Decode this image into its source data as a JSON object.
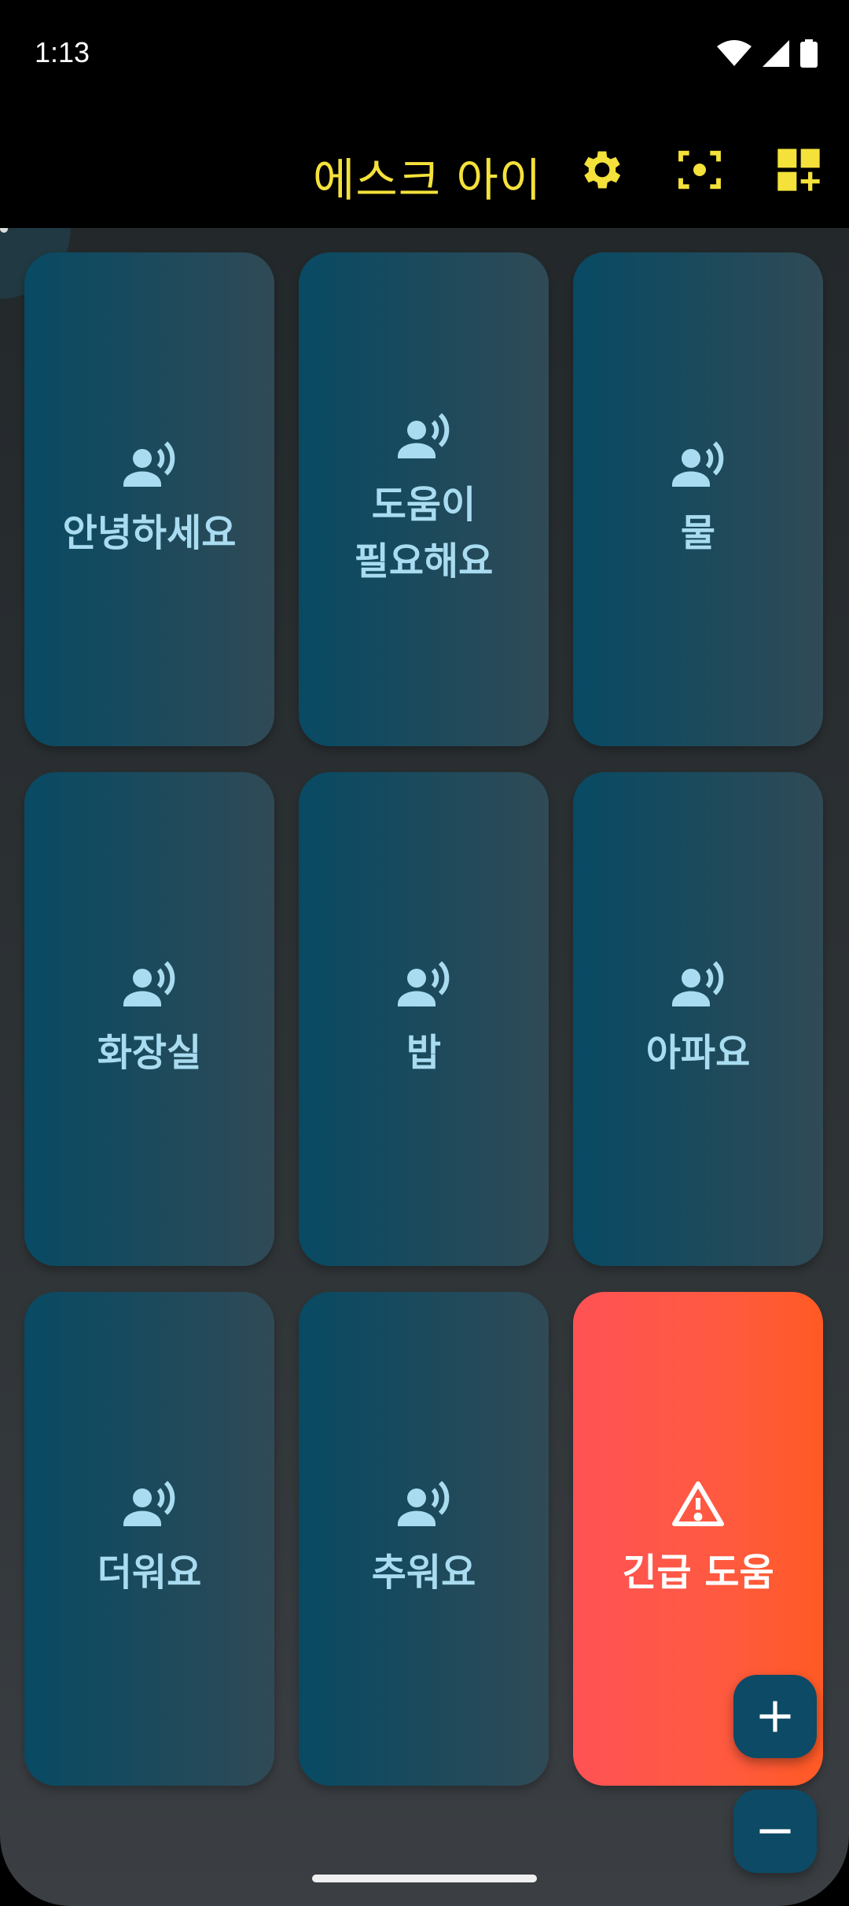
{
  "status_bar": {
    "time": "1:13",
    "icons": [
      "wifi-icon",
      "signal-icon",
      "battery-icon"
    ]
  },
  "app_bar": {
    "title": "에스크 아이",
    "title_color": "#f4e13a",
    "actions": [
      "settings-icon",
      "scan-icon",
      "add-widget-icon"
    ]
  },
  "tiles": [
    {
      "label": "안녕하세요",
      "icon": "speak-icon"
    },
    {
      "label": "도움이 필요해요",
      "icon": "speak-icon"
    },
    {
      "label": "물",
      "icon": "speak-icon"
    },
    {
      "label": "화장실",
      "icon": "speak-icon"
    },
    {
      "label": "밥",
      "icon": "speak-icon"
    },
    {
      "label": "아파요",
      "icon": "speak-icon"
    },
    {
      "label": "더워요",
      "icon": "speak-icon"
    },
    {
      "label": "추워요",
      "icon": "speak-icon"
    },
    {
      "label": "긴급 도움",
      "icon": "warning-icon",
      "accent": "#ff5440"
    }
  ],
  "fabs": [
    "zoom-in-icon",
    "zoom-out-icon"
  ]
}
